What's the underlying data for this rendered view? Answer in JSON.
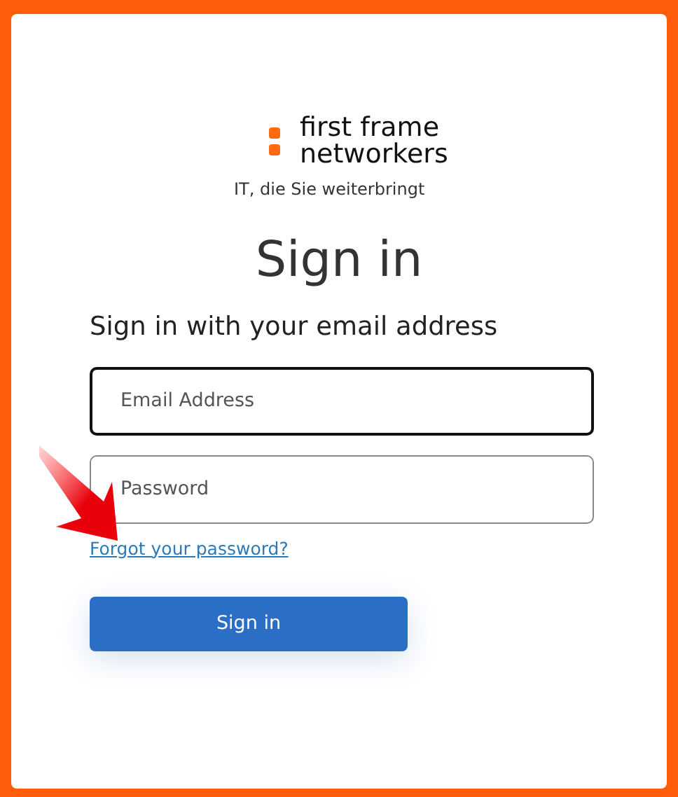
{
  "logo": {
    "lines": [
      "first frame",
      "networkers"
    ],
    "tagline": "IT, die Sie weiterbringt"
  },
  "heading": "Sign in",
  "subheading": "Sign in with your email address",
  "fields": [
    {
      "placeholder": "Email Address",
      "focused": true
    },
    {
      "placeholder": "Password",
      "focused": false
    }
  ],
  "forgot_link": "Forgot your password?",
  "button": "Sign in",
  "annotation": {
    "kind": "arrow"
  }
}
